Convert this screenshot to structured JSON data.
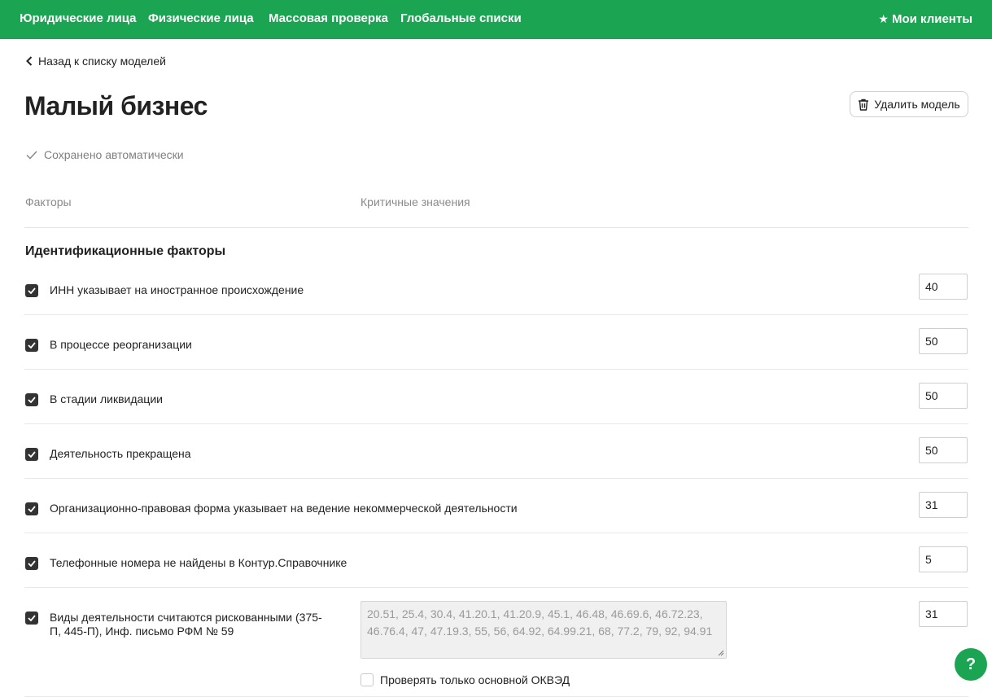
{
  "nav": {
    "items": [
      "Юридические лица",
      "Физические лица",
      "Массовая проверка",
      "Глобальные списки"
    ],
    "my_clients": "Мои клиенты"
  },
  "back_link": "Назад к списку моделей",
  "page_title": "Малый бизнес",
  "delete_button": "Удалить модель",
  "saved_status": "Сохранено автоматически",
  "columns": {
    "factors": "Факторы",
    "critical_values": "Критичные значения"
  },
  "section": {
    "title": "Идентификационные факторы",
    "factors": [
      {
        "label": "ИНН указывает на иностранное происхождение",
        "value": "40",
        "checked": true
      },
      {
        "label": "В процессе реорганизации",
        "value": "50",
        "checked": true
      },
      {
        "label": "В стадии ликвидации",
        "value": "50",
        "checked": true
      },
      {
        "label": "Деятельность прекращена",
        "value": "50",
        "checked": true
      },
      {
        "label": "Организационно-правовая форма указывает на ведение некоммерческой деятельности",
        "value": "31",
        "checked": true
      },
      {
        "label": "Телефонные номера не найдены в Контур.Справочнике",
        "value": "5",
        "checked": true
      },
      {
        "label": "Виды деятельности считаются рискованными (375-П, 445-П), Инф. письмо РФМ № 59",
        "value": "31",
        "checked": true
      }
    ]
  },
  "okved": {
    "codes": "20.51, 25.4, 30.4, 41.20.1, 41.20.9, 45.1, 46.48, 46.69.6, 46.72.23, 46.76.4, 47, 47.19.3, 55, 56, 64.92, 64.99.21, 68, 77.2, 79, 92, 94.91",
    "only_main_label": "Проверять только основной ОКВЭД"
  },
  "help_button": "?",
  "colors": {
    "brand_green": "#1ba553",
    "checkbox_dark": "#333333"
  },
  "icons": [
    "star-icon",
    "chevron-left-icon",
    "trash-icon",
    "check-icon",
    "checkbox-checked-icon",
    "resize-grip-icon",
    "help-icon"
  ]
}
